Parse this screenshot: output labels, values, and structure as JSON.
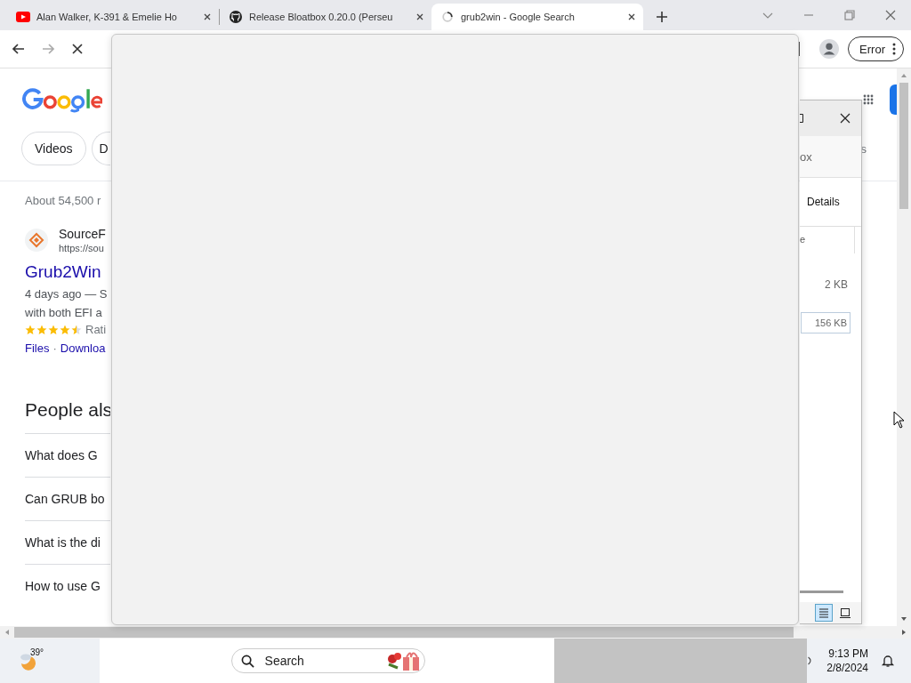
{
  "browser": {
    "tabs": [
      {
        "kind": "video",
        "title": "Alan Walker, K-391 & Emelie Ho",
        "selected": false
      },
      {
        "kind": "code",
        "title": "Release Bloatbox 0.20.0 (Perseu",
        "selected": false
      },
      {
        "kind": "search",
        "title": "grub2win - Google Search",
        "selected": true
      }
    ],
    "profile_status": "Error"
  },
  "google": {
    "chips": [
      "Videos",
      "D"
    ],
    "tab_fragment": "s",
    "result_count": "About 54,500 r",
    "result": {
      "site": "SourceF",
      "url": "https://sou",
      "title": "Grub2Win",
      "snippet_lines": [
        "4 days ago — S",
        "with both EFI a"
      ],
      "stars": 4.5,
      "rating_label": "Rati",
      "links": [
        "Files",
        "Downloa"
      ],
      "link_separator": "·"
    },
    "people_also_ask": {
      "heading": "People als",
      "questions": [
        "What does G",
        "Can GRUB bo",
        "What is the di",
        "How to use G"
      ]
    }
  },
  "dialog": {
    "title_fragment": "ox",
    "tab": "Details",
    "column_fragment": "e",
    "size": "2 KB",
    "selected_size": "156 KB",
    "views": [
      {
        "kind": "details",
        "selected": true
      },
      {
        "kind": "preview",
        "selected": false
      }
    ]
  },
  "taskbar": {
    "weather": "39°",
    "search_placeholder": "Search",
    "time": "9:13 PM",
    "date": "2/8/2024"
  }
}
